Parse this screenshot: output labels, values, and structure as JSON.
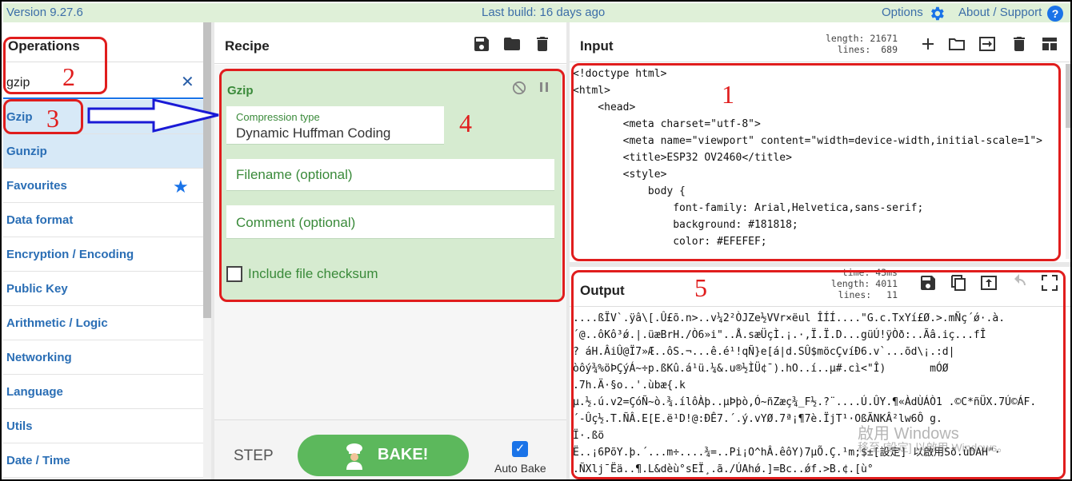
{
  "banner": {
    "version": "Version 9.27.6",
    "last_build": "Last build: 16 days ago",
    "options": "Options",
    "about": "About / Support",
    "help": "?"
  },
  "operations": {
    "title": "Operations",
    "search_value": "gzip",
    "clear": "✕",
    "items": [
      {
        "label": "Gzip"
      },
      {
        "label": "Gunzip"
      },
      {
        "label": "Favourites"
      },
      {
        "label": "Data format"
      },
      {
        "label": "Encryption / Encoding"
      },
      {
        "label": "Public Key"
      },
      {
        "label": "Arithmetic / Logic"
      },
      {
        "label": "Networking"
      },
      {
        "label": "Language"
      },
      {
        "label": "Utils"
      },
      {
        "label": "Date / Time"
      }
    ]
  },
  "recipe": {
    "title": "Recipe",
    "card": {
      "name": "Gzip",
      "compression_label": "Compression type",
      "compression_value": "Dynamic Huffman Coding",
      "filename_placeholder": "Filename (optional)",
      "comment_placeholder": "Comment (optional)",
      "checksum_label": "Include file checksum"
    },
    "step": "STEP",
    "bake": "BAKE!",
    "auto_bake": "Auto Bake"
  },
  "input": {
    "title": "Input",
    "length_label": "length:",
    "length": "21671",
    "lines_label": "lines:",
    "lines": "689",
    "code": "<!doctype html>\n<html>\n    <head>\n        <meta charset=\"utf-8\">\n        <meta name=\"viewport\" content=\"width=device-width,initial-scale=1\">\n        <title>ESP32 OV2460</title>\n        <style>\n            body {\n                font-family: Arial,Helvetica,sans-serif;\n                background: #181818;\n                color: #EFEFEF;"
  },
  "output": {
    "title": "Output",
    "time": "time: 43ms",
    "length_label": "length:",
    "length": "4011",
    "lines_label": "lines:",
    "lines": "11",
    "code": "....ßÏV`.ÿâ\\[.Û£õ.n>..v¼2²ÒJZe½VVr×ëul ÎÍÍ....\"G.c.TxYí£Ø.>.mÑç´ǿ·.à.\n´@..ôKô³ǿ.|.üæBrH./Ò6»i\"..Å.sæÜçÌ.¡.·,Ï.Ï.D...güÚ!ÿÒð:..Ãâ.iç...fÎ\n? áH.ÂiÛ@Ï7»Æ..ôS.¬...ê.é¹!qÑ}e[á|d.SÛ$möcÇvíÐ6.v`...õd\\¡.:d|\nòôý¾%öÞÇýÁ~÷p.ßKû.á¹ü.¼&.u®½ÌÜ¢¯).hO..í..µ#.cì<\"Î)       mÓØ\n.7h.Ä·§o..'.ùbæ{.k\nµ.½.ú.v2=ÇóÑ~ò.¾.ílôÀþ..µÞþò,Ó~ñZæç¾_F½.?¨....Ú.ÛY.¶«ÀdÙÁÒ1 .©C*ñÜX.7Ú©ÁF.\n´-Ûç½.T.ÑÂ.E[E.ë¹D!@:ÐÊ7.´.ý.vYØ.7ª¡¶7è.ÏjT¹·OßÃNKÂ²lw6Ô g.\nÏ·.ßö\nË..¡6PõY.þ.´...m÷....¾=..Pi¡O^hÂ.êôY)7µÕ.Ç.¹m;$±[設定] 以啟用Sð.ùDAH\"·\n.ÑXlj¯Ëä..¶.L&dèù°sEÏ¸.ã./ÚAhǿ.]=Bc..ǿf.>B.¢.[ù°"
  },
  "watermark": {
    "line1": "啟用 Windows",
    "line2": "移至 [設定] 以啟用 Windows。"
  },
  "annotations": [
    "1",
    "2",
    "3",
    "4",
    "5"
  ],
  "colors": {
    "banner_bg": "#dff0d8",
    "link_blue": "#2a6eb5",
    "recipe_card": "#d6ebd0",
    "bake_green": "#5cb85c",
    "annotation_red": "#e01d1d"
  }
}
